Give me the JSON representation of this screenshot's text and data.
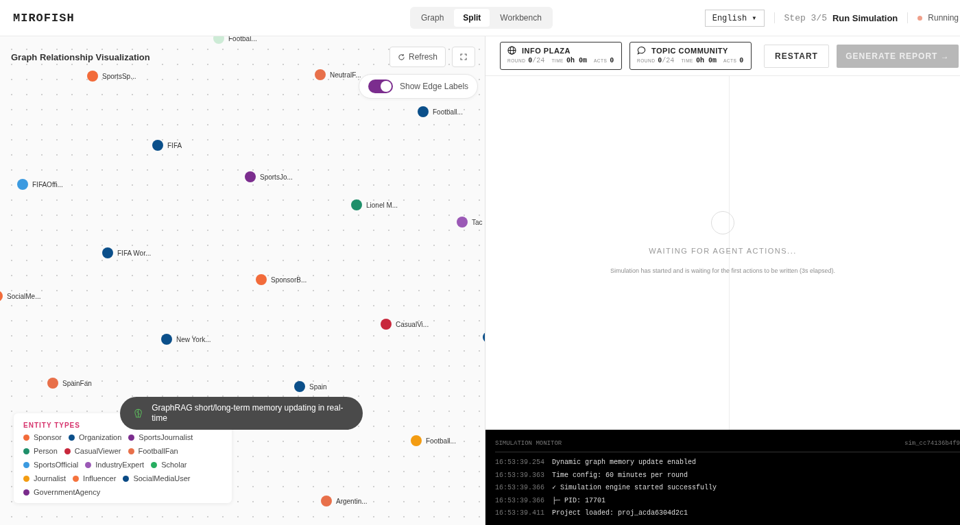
{
  "header": {
    "logo": "MIROFISH",
    "view_tabs": [
      {
        "label": "Graph",
        "selected": false
      },
      {
        "label": "Split",
        "selected": true
      },
      {
        "label": "Workbench",
        "selected": false
      }
    ],
    "language": "English ▾",
    "step": "Step 3/5",
    "step_title": "Run Simulation",
    "status": "Running"
  },
  "graph_panel": {
    "title": "Graph Relationship Visualization",
    "refresh": "Refresh",
    "edge_labels_toggle": {
      "label": "Show Edge Labels",
      "on": true
    },
    "nodes": [
      {
        "label": "Footbal...",
        "color": "#cdebd6"
      },
      {
        "label": "SportsSp...",
        "color": "#f26b3a"
      },
      {
        "label": "NeutralF...",
        "color": "#e8704a"
      },
      {
        "label": "Football...",
        "color": "#0b4f8a"
      },
      {
        "label": "FIFA",
        "color": "#0b4f8a"
      },
      {
        "label": "FIFAOffi...",
        "color": "#3b9ae0"
      },
      {
        "label": "SportsJo...",
        "color": "#7b2d8e"
      },
      {
        "label": "Lionel M...",
        "color": "#1f8f6a"
      },
      {
        "label": "Tac",
        "color": "#9b59b6"
      },
      {
        "label": "FIFA Wor...",
        "color": "#0b4f8a"
      },
      {
        "label": "SponsorB...",
        "color": "#f26b3a"
      },
      {
        "label": "SocialMe...",
        "color": "#f26b3a"
      },
      {
        "label": "CasualVi...",
        "color": "#c8283c"
      },
      {
        "label": "New York...",
        "color": "#0b4f8a"
      },
      {
        "color": "#0b4f8a"
      },
      {
        "label": "SpainFan",
        "color": "#e8704a"
      },
      {
        "label": "Spain",
        "color": "#0b4f8a"
      },
      {
        "label": "Football...",
        "color": "#f39c12"
      },
      {
        "label": "Argentin...",
        "color": "#e8704a"
      }
    ],
    "toast": "GraphRAG short/long-term memory updating in real-time",
    "legend": {
      "title": "ENTITY TYPES",
      "items": [
        {
          "label": "Sponsor",
          "color": "#f26b3a"
        },
        {
          "label": "Organization",
          "color": "#0b4f8a"
        },
        {
          "label": "SportsJournalist",
          "color": "#7b2d8e"
        },
        {
          "label": "Person",
          "color": "#1f8f6a"
        },
        {
          "label": "CasualViewer",
          "color": "#c8283c"
        },
        {
          "label": "FootballFan",
          "color": "#e8704a"
        },
        {
          "label": "SportsOfficial",
          "color": "#3b9ae0"
        },
        {
          "label": "IndustryExpert",
          "color": "#9b59b6"
        },
        {
          "label": "Scholar",
          "color": "#27ae60"
        },
        {
          "label": "Journalist",
          "color": "#f39c12"
        },
        {
          "label": "Influencer",
          "color": "#f5733d"
        },
        {
          "label": "SocialMediaUser",
          "color": "#0a4a85"
        },
        {
          "label": "GovernmentAgency",
          "color": "#7a2c8c"
        }
      ]
    }
  },
  "simulation_panel": {
    "platforms": [
      {
        "kind": "globe",
        "name": "INFO PLAZA",
        "stats": [
          {
            "label": "ROUND",
            "value": "0",
            "total": "/24"
          },
          {
            "label": "TIME",
            "value": "0h 0m"
          },
          {
            "label": "ACTS",
            "value": "0"
          }
        ]
      },
      {
        "kind": "chat",
        "name": "TOPIC COMMUNITY",
        "stats": [
          {
            "label": "ROUND",
            "value": "0",
            "total": "/24"
          },
          {
            "label": "TIME",
            "value": "0h 0m"
          },
          {
            "label": "ACTS",
            "value": "0"
          }
        ]
      }
    ],
    "restart": "RESTART",
    "generate_report": {
      "label": "GENERATE REPORT →",
      "disabled": true
    },
    "empty_title": "WAITING FOR AGENT ACTIONS...",
    "empty_text": "Simulation has started and is waiting for the first actions to be written (3s elapsed).",
    "monitor": {
      "title": "SIMULATION MONITOR",
      "sim_id": "sim_cc74136b4f9",
      "logs": [
        {
          "time": "16:53:39.254",
          "message": "Dynamic graph memory update enabled"
        },
        {
          "time": "16:53:39.363",
          "message": "Time config: 60 minutes per round"
        },
        {
          "time": "16:53:39.366",
          "message": "✓ Simulation engine started successfully"
        },
        {
          "time": "16:53:39.366",
          "message": "├─ PID: 17701"
        },
        {
          "time": "16:53:39.411",
          "message": "Project loaded: proj_acda6304d2c1"
        }
      ]
    }
  }
}
